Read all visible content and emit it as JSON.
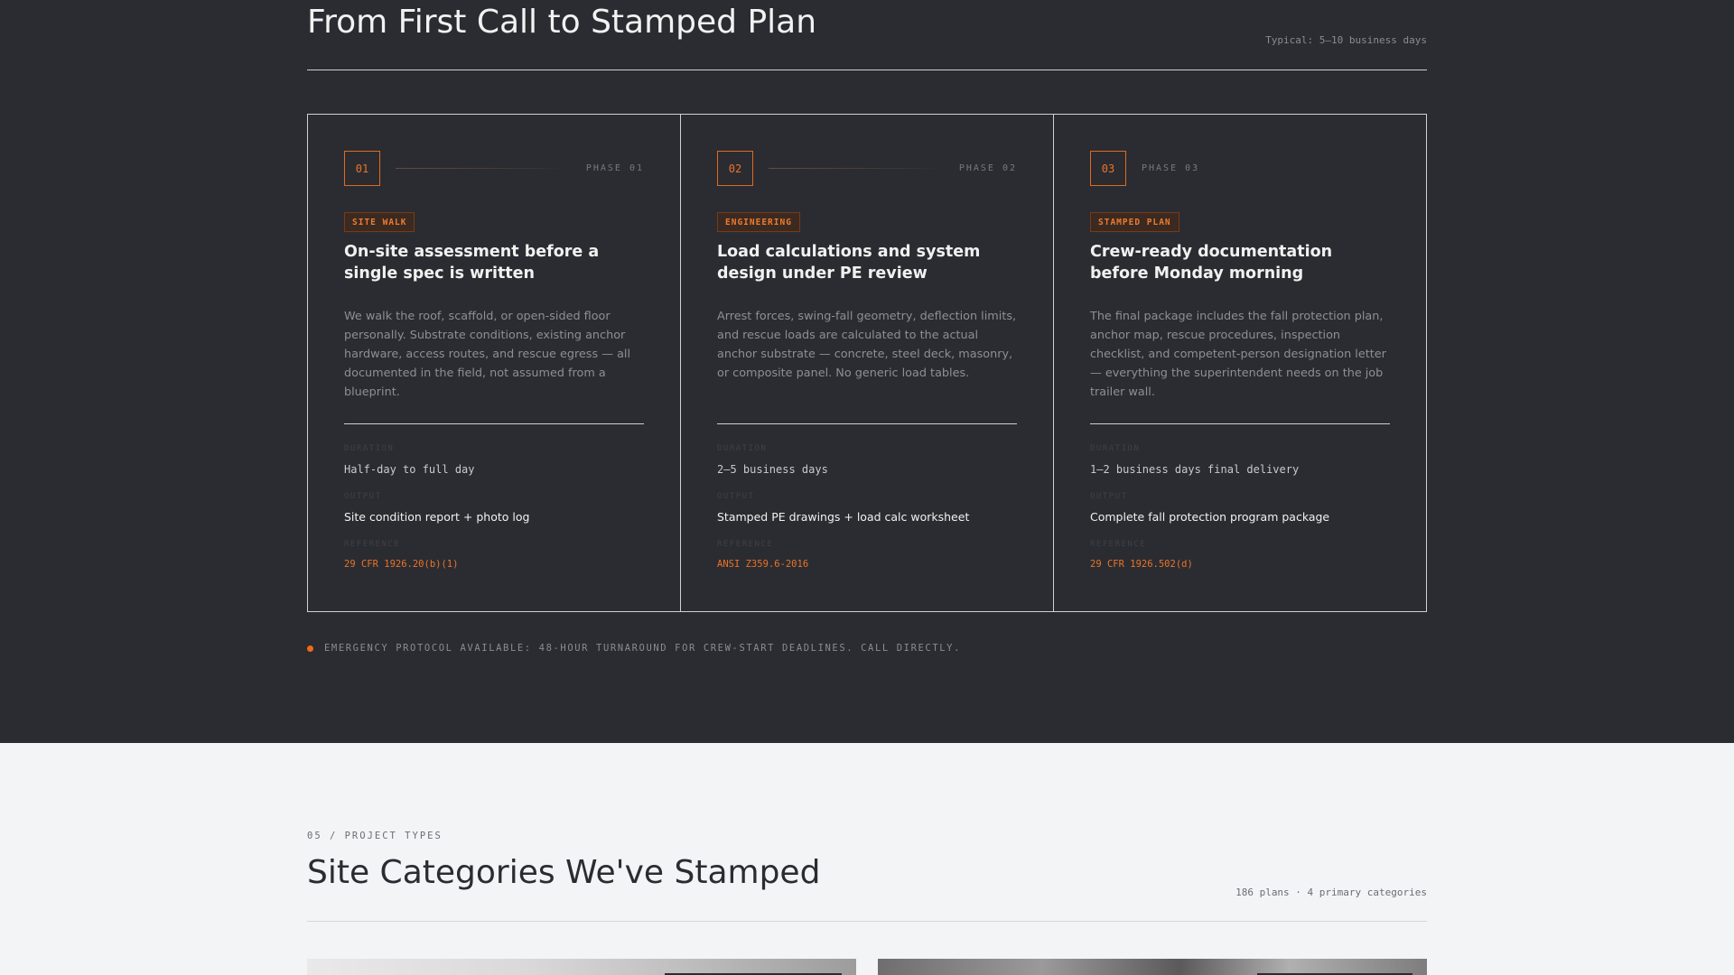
{
  "process": {
    "title": "From First Call to Stamped Plan",
    "meta": "Typical: 5–10 business days",
    "phases": [
      {
        "number": "01",
        "phase_label": "PHASE 01",
        "tag": "SITE WALK",
        "title": "On-site assessment before a single spec is written",
        "description": "We walk the roof, scaffold, or open-sided floor personally. Substrate conditions, existing anchor hardware, access routes, and rescue egress — all documented in the field, not assumed from a blueprint.",
        "duration_label": "DURATION",
        "duration": "Half-day to full day",
        "output_label": "OUTPUT",
        "output": "Site condition report + photo log",
        "reference_label": "REFERENCE",
        "reference": "29 CFR 1926.20(b)(1)"
      },
      {
        "number": "02",
        "phase_label": "PHASE 02",
        "tag": "ENGINEERING",
        "title": "Load calculations and system design under PE review",
        "description": "Arrest forces, swing-fall geometry, deflection limits, and rescue loads are calculated to the actual anchor substrate — concrete, steel deck, masonry, or composite panel. No generic load tables.",
        "duration_label": "DURATION",
        "duration": "2–5 business days",
        "output_label": "OUTPUT",
        "output": "Stamped PE drawings + load calc worksheet",
        "reference_label": "REFERENCE",
        "reference": "ANSI Z359.6-2016"
      },
      {
        "number": "03",
        "phase_label": "PHASE 03",
        "tag": "STAMPED PLAN",
        "title": "Crew-ready documentation before Monday morning",
        "description": "The final package includes the fall protection plan, anchor map, rescue procedures, inspection checklist, and competent-person designation letter — everything the superintendent needs on the job trailer wall.",
        "duration_label": "DURATION",
        "duration": "1–2 business days final delivery",
        "output_label": "OUTPUT",
        "output": "Complete fall protection program package",
        "reference_label": "REFERENCE",
        "reference": "29 CFR 1926.502(d)"
      }
    ],
    "notice": "EMERGENCY PROTOCOL AVAILABLE: 48-HOUR TURNAROUND FOR CREW-START DEADLINES. CALL DIRECTLY."
  },
  "categories": {
    "eyebrow": "05 / PROJECT TYPES",
    "title": "Site Categories We've Stamped",
    "meta": "186 plans · 4 primary categories"
  },
  "colors": {
    "accent": "#e9732a",
    "dark_bg": "#2b2c31",
    "light_bg": "#f3f4f6"
  }
}
